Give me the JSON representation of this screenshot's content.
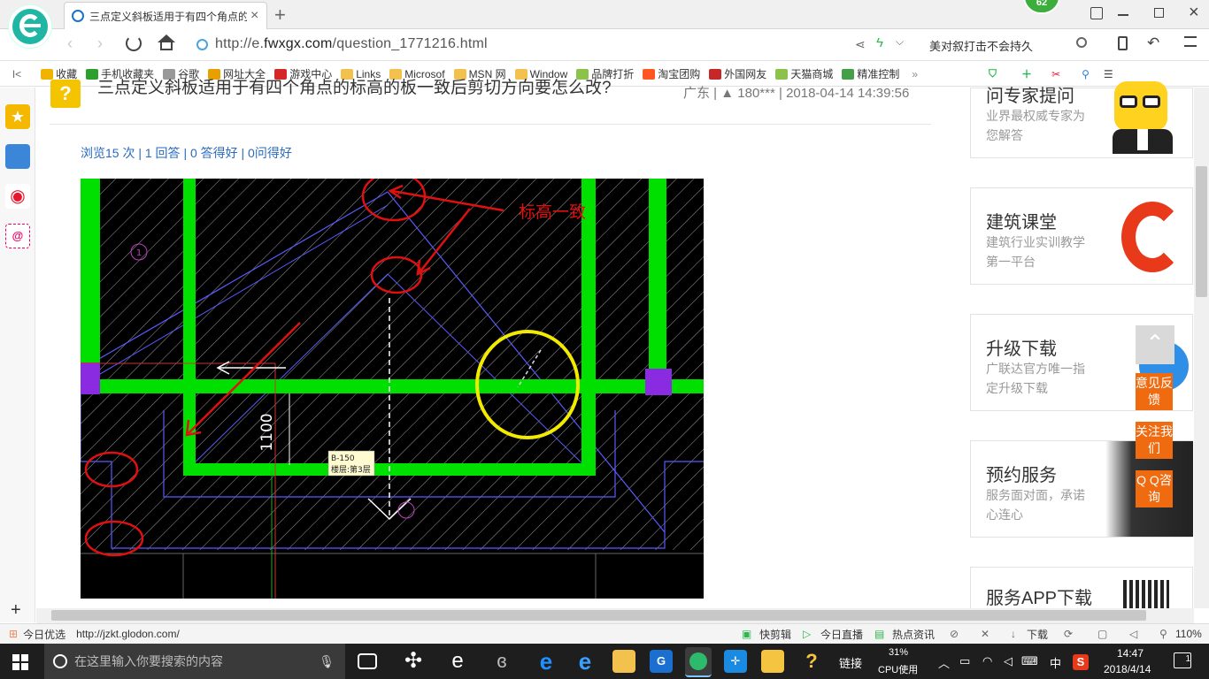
{
  "browser": {
    "tab_title": "三点定义斜板适用于有四个角点的",
    "url_prefix": "http://e.",
    "url_domain": "fwxgx.com",
    "url_path": "/question_1771216.html",
    "search_hint": "美对叙打击不会持久",
    "badge_count": "62"
  },
  "bookmarks": [
    {
      "label": "收藏",
      "color": "#f0b400"
    },
    {
      "label": "手机收藏夹",
      "color": "#2ca02c"
    },
    {
      "label": "谷歌",
      "color": "#999999"
    },
    {
      "label": "网址大全",
      "color": "#e8a000"
    },
    {
      "label": "游戏中心",
      "color": "#d62728"
    },
    {
      "label": "Links",
      "color": "#f2c14e"
    },
    {
      "label": "Microsof",
      "color": "#f2c14e"
    },
    {
      "label": "MSN 网",
      "color": "#f2c14e"
    },
    {
      "label": "Window",
      "color": "#f2c14e"
    },
    {
      "label": "品牌打折",
      "color": "#8bc34a"
    },
    {
      "label": "淘宝团购",
      "color": "#ff5722"
    },
    {
      "label": "外国网友",
      "color": "#c62828"
    },
    {
      "label": "天猫商城",
      "color": "#8bc34a"
    },
    {
      "label": "精准控制",
      "color": "#43a047"
    }
  ],
  "question": {
    "title": "三点定义斜板适用于有四个角点的标高的板一致后剪切方向要怎么改?",
    "location": "广东",
    "user": "180***",
    "datetime": "2018-04-14 14:39:56",
    "stats": "浏览15 次 | 1 回答 | 0 答得好 | 0问得好"
  },
  "cad": {
    "annotation": "标高一致",
    "dimension": "1100",
    "tooltip_line1": "B-150",
    "tooltip_line2": "楼层:第3层",
    "axis_marker": "1"
  },
  "sidebar": {
    "cards": [
      {
        "title": "问专家提问",
        "desc": "业界最权威专家为您解答"
      },
      {
        "title": "建筑课堂",
        "desc": "建筑行业实训教学第一平台"
      },
      {
        "title": "升级下载",
        "desc": "广联达官方唯一指定升级下载"
      },
      {
        "title": "预约服务",
        "desc": "服务面对面，承诺心连心"
      },
      {
        "title": "服务APP下载",
        "desc": ""
      }
    ],
    "float_buttons": [
      "意见反馈",
      "关注我们",
      "Q Q咨询"
    ]
  },
  "status": {
    "left_label": "今日优选",
    "link": "http://jzkt.glodon.com/",
    "kuaijianji": "快剪辑",
    "zhibo": "今日直播",
    "zixun": "热点资讯",
    "download": "下载",
    "zoom": "110%"
  },
  "taskbar": {
    "search_placeholder": "在这里输入你要搜索的内容",
    "link_label": "链接",
    "cpu_percent": "31%",
    "cpu_label": "CPU使用",
    "lang": "中",
    "time": "14:47",
    "date": "2018/4/14",
    "notif": "1"
  }
}
